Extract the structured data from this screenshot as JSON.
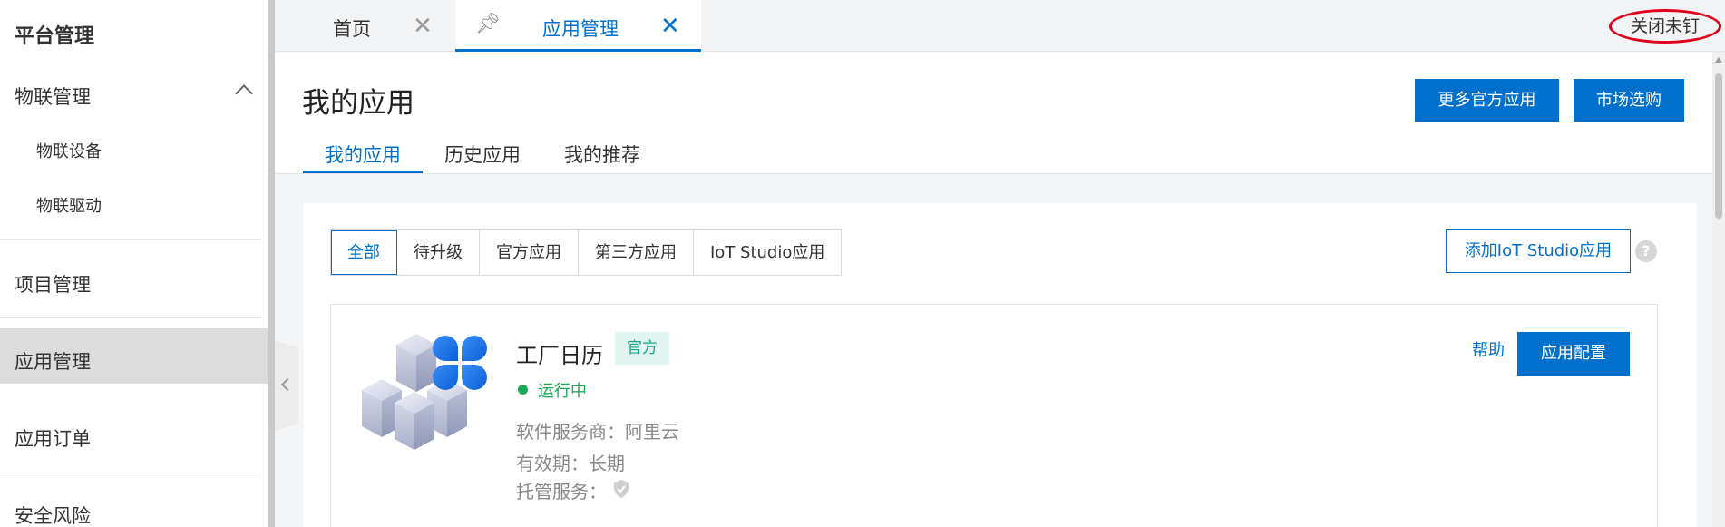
{
  "sidebar": {
    "title": "平台管理",
    "groups": [
      {
        "label": "物联管理",
        "children": [
          "物联设备",
          "物联驱动"
        ]
      }
    ],
    "items": [
      "项目管理",
      "应用管理",
      "应用订单",
      "安全风险"
    ]
  },
  "tabs": {
    "home_label": "首页",
    "app_label": "应用管理",
    "close_unpinned": "关闭未钉"
  },
  "page": {
    "title": "我的应用",
    "more_official_button": "更多官方应用",
    "market_button": "市场选购",
    "subtabs": [
      "我的应用",
      "历史应用",
      "我的推荐"
    ]
  },
  "filters": [
    "全部",
    "待升级",
    "官方应用",
    "第三方应用",
    "IoT Studio应用"
  ],
  "add_iot_studio_button": "添加IoT Studio应用",
  "help_icon_text": "?",
  "app": {
    "name": "工厂日历",
    "badge": "官方",
    "status": "运行中",
    "vendor": "软件服务商：阿里云",
    "validity": "有效期：长期",
    "hosting": "托管服务：",
    "help_link": "帮助",
    "config_button": "应用配置"
  },
  "colors": {
    "accent": "#0070cc",
    "status_green": "#1aaa55",
    "badge_bg": "#e0f5f0",
    "badge_text": "#1aa38a",
    "annotation_red": "#e0001b"
  }
}
